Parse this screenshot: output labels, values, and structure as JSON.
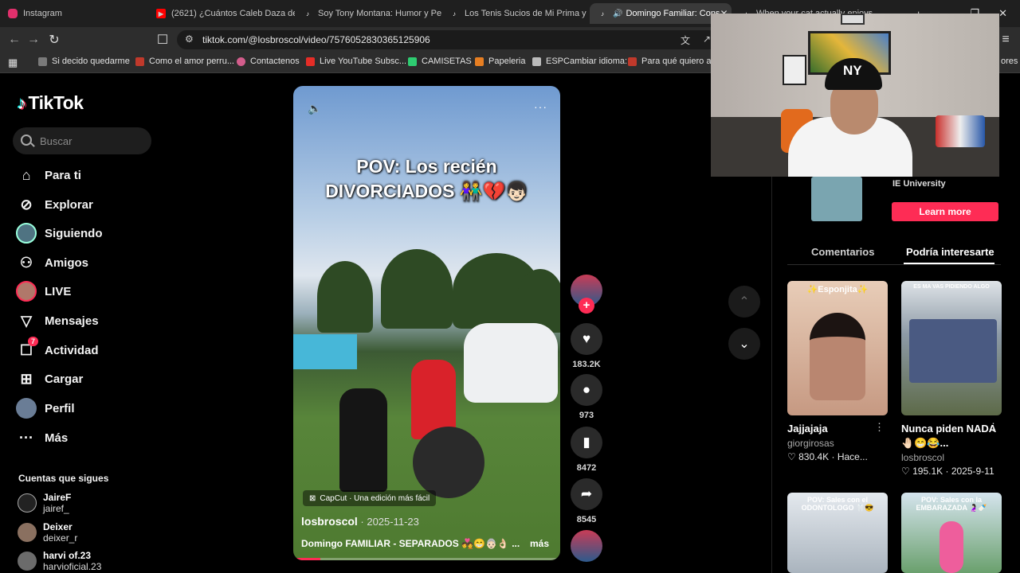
{
  "browser": {
    "tabs": [
      {
        "title": "Instagram",
        "icon": "instagram-icon",
        "color": "#e1306c"
      },
      {
        "title": "(2621) ¿Cuántos Caleb Daza de",
        "icon": "youtube-icon",
        "color": "#ff0000"
      },
      {
        "title": "Soy Tony Montana: Humor y Pe",
        "icon": "tiktok-icon",
        "color": "#000000"
      },
      {
        "title": "Los Tenis Sucios de Mi Prima y c",
        "icon": "tiktok-icon",
        "color": "#000000"
      },
      {
        "title": "Domingo Familiar: Cons",
        "icon": "tiktok-icon",
        "color": "#000000",
        "active": true
      },
      {
        "title": "When your cat actually enjoys",
        "icon": "tiktok-icon",
        "color": "#000000"
      }
    ],
    "url": "tiktok.com/@losbroscol/video/7576052830365125906",
    "bookmarks": [
      {
        "label": "Si decido quedarme",
        "color": "#7a7a7a"
      },
      {
        "label": "Como el amor perru...",
        "color": "#c0392b"
      },
      {
        "label": "Contactenos",
        "color": "#d35d8c"
      },
      {
        "label": "Live YouTube Subsc...",
        "color": "#e52d27"
      },
      {
        "label": "CAMISETAS",
        "color": "#2ecc71"
      },
      {
        "label": "Papeleria",
        "color": "#e67e22"
      },
      {
        "label": "ESPCambiar idioma:",
        "color": "#bbbbbb"
      },
      {
        "label": "Para qué quiero asp",
        "color": "#c0392b"
      }
    ],
    "bookmarks_tail": "ores"
  },
  "sidebar": {
    "logo": "TikTok",
    "search_placeholder": "Buscar",
    "nav": [
      {
        "label": "Para ti",
        "icon": "home-icon"
      },
      {
        "label": "Explorar",
        "icon": "compass-icon"
      },
      {
        "label": "Siguiendo",
        "icon": "following-avatar-icon"
      },
      {
        "label": "Amigos",
        "icon": "friends-icon"
      },
      {
        "label": "LIVE",
        "icon": "live-avatar-icon"
      },
      {
        "label": "Mensajes",
        "icon": "send-icon"
      },
      {
        "label": "Actividad",
        "icon": "inbox-icon",
        "badge": "7"
      },
      {
        "label": "Cargar",
        "icon": "upload-icon"
      },
      {
        "label": "Perfil",
        "icon": "profile-avatar-icon"
      },
      {
        "label": "Más",
        "icon": "more-dots-icon"
      }
    ],
    "following_title": "Cuentas que sigues",
    "following": [
      {
        "name": "JaireF",
        "handle": "jairef_"
      },
      {
        "name": "Deixer",
        "handle": "deixer_r"
      },
      {
        "name": "harvi of.23",
        "handle": "harvioficial.23"
      }
    ]
  },
  "video": {
    "caption_line1": "POV: Los recién",
    "caption_line2": "DIVORCIADOS 👫💔👦🏻",
    "capcut_label": "CapCut · Una edición más fácil",
    "author": "losbroscol",
    "date": " · 2025-11-23",
    "description": "Domingo FAMILIAR - SEPARADOS 💑😁👵🏻👌🏻 ...",
    "more_label": "más",
    "progress_fraction": 0.1
  },
  "actions": {
    "likes": "183.2K",
    "comments": "973",
    "saves": "8472",
    "shares": "8545"
  },
  "right_panel": {
    "ad_name": "IE University",
    "learn_more": "Learn more",
    "tabs": [
      "Comentarios",
      "Podría interesarte"
    ],
    "active_tab": 1,
    "cards": [
      {
        "overlay": "✨Esponjita✨",
        "title": "Jajjajaja",
        "author": "giorgirosas",
        "likes": "830.4K",
        "date": "Hace...",
        "bg": "#d7b39e"
      },
      {
        "overlay": "ES MA VAS PIDIENDO ALGO",
        "title": "Nunca piden NADA 🤚🏻😁😂...",
        "author": "losbroscol",
        "likes": "195.1K",
        "date": "2025-9-11",
        "bg": "#8d9aa6"
      },
      {
        "overlay": "POV: Sales con el ODONTOLOGO 🦷😎",
        "title": "",
        "author": "",
        "likes": "",
        "date": "",
        "bg": "#c9d3dc"
      },
      {
        "overlay": "POV: Sales con la EMBARAZADA 🤰🏻🍼",
        "title": "",
        "author": "",
        "likes": "",
        "date": "",
        "bg": "#6aa06d"
      }
    ]
  }
}
